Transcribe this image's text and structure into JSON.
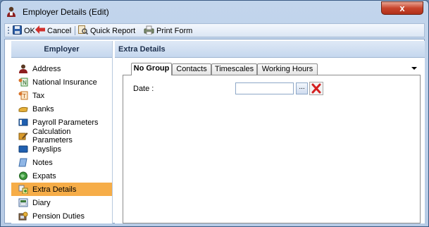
{
  "window": {
    "title": "Employer Details (Edit)",
    "close_label": "x"
  },
  "toolbar": {
    "ok_label": "OK",
    "cancel_label": "Cancel",
    "quick_report_label": "Quick Report",
    "print_form_label": "Print Form"
  },
  "sidebar": {
    "header": "Employer",
    "selected": "Extra Details",
    "items": [
      {
        "label": "Address",
        "icon": "person-icon"
      },
      {
        "label": "National Insurance",
        "icon": "ni-icon"
      },
      {
        "label": "Tax",
        "icon": "tax-icon"
      },
      {
        "label": "Banks",
        "icon": "bank-icon"
      },
      {
        "label": "Payroll Parameters",
        "icon": "book-icon"
      },
      {
        "label": "Calculation Parameters",
        "icon": "pencil-icon"
      },
      {
        "label": "Payslips",
        "icon": "payslip-icon"
      },
      {
        "label": "Notes",
        "icon": "notes-icon"
      },
      {
        "label": "Expats",
        "icon": "globe-icon"
      },
      {
        "label": "Extra Details",
        "icon": "extra-details-icon"
      },
      {
        "label": "Diary",
        "icon": "diary-icon"
      },
      {
        "label": "Pension Duties",
        "icon": "pension-icon"
      }
    ]
  },
  "main": {
    "header": "Extra Details",
    "tabs": [
      {
        "label": "No Group",
        "active": true
      },
      {
        "label": "Contacts",
        "active": false
      },
      {
        "label": "Timescales",
        "active": false
      },
      {
        "label": "Working Hours",
        "active": false
      }
    ],
    "fields": {
      "date_label": "Date :",
      "date_value": "",
      "date_button_label": "..."
    }
  },
  "colors": {
    "selected_item": "#f6ad48",
    "header_text": "#1c2f4d",
    "clear_icon": "#d42020"
  }
}
